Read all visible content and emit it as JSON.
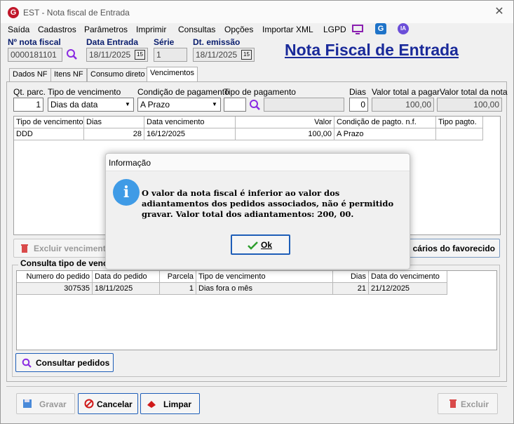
{
  "window": {
    "title": "EST - Nota fiscal de Entrada",
    "app_logo": "G",
    "close": "✕"
  },
  "menu": [
    "Saída",
    "Cadastros",
    "Parâmetros",
    "Imprimir",
    "Consultas",
    "Opções",
    "Importar XML",
    "LGPD"
  ],
  "menu_icons": {
    "monitor": "monitor-icon",
    "g": "G",
    "ia": "IA"
  },
  "header": {
    "nf_label": "Nº nota fiscal",
    "nf_value": "0000181101",
    "entrada_label": "Data Entrada",
    "entrada_value": "18/11/2025",
    "serie_label": "Série",
    "serie_value": "1",
    "emissao_label": "Dt. emissão",
    "emissao_value": "18/11/2025",
    "cal_label": "15",
    "page_title": "Nota Fiscal de Entrada"
  },
  "tabs": [
    "Dados NF",
    "Itens NF",
    "Consumo direto",
    "Vencimentos"
  ],
  "form": {
    "qt_parc_label": "Qt. parc.",
    "qt_parc_value": "1",
    "tipo_venc_label": "Tipo de vencimento",
    "tipo_venc_value": "Dias da data",
    "cond_pag_label": "Condição de pagamento",
    "cond_pag_value": "A Prazo",
    "tipo_pag_label": "Tipo de pagamento",
    "tipo_pag_value": "",
    "dias_label": "Dias",
    "dias_value": "0",
    "valor_pagar_label": "Valor total a pagar",
    "valor_pagar_value": "100,00",
    "valor_nota_label": "Valor total da nota",
    "valor_nota_value": "100,00"
  },
  "venc_grid": {
    "headers": [
      "Tipo de vencimento",
      "Dias",
      "Data vencimento",
      "Valor",
      "Condição de pagto. n.f.",
      "Tipo pagto."
    ],
    "rows": [
      [
        "DDD",
        "28",
        "16/12/2025",
        "100,00",
        "A Prazo",
        ""
      ]
    ]
  },
  "buttons": {
    "excluir_venc": "Excluir vencimento",
    "bancarios": "cários do favorecido",
    "consultar": "Consultar pedidos",
    "gravar": "Gravar",
    "cancelar": "Cancelar",
    "limpar": "Limpar",
    "excluir": "Excluir"
  },
  "consulta": {
    "title": "Consulta tipo de venc",
    "headers": [
      "Numero do pedido",
      "Data do pedido",
      "Parcela",
      "Tipo de vencimento",
      "Dias",
      "Data do vencimento"
    ],
    "rows": [
      [
        "307535",
        "18/11/2025",
        "1",
        "Dias fora o mês",
        "21",
        "21/12/2025"
      ]
    ]
  },
  "dialog": {
    "title": "Informação",
    "icon": "i",
    "message": "O valor da nota fiscal é inferior ao valor dos adiantamentos dos pedidos associados, não é permitido gravar. Valor total dos adiantamentos: 200, 00.",
    "ok": "Ok"
  }
}
